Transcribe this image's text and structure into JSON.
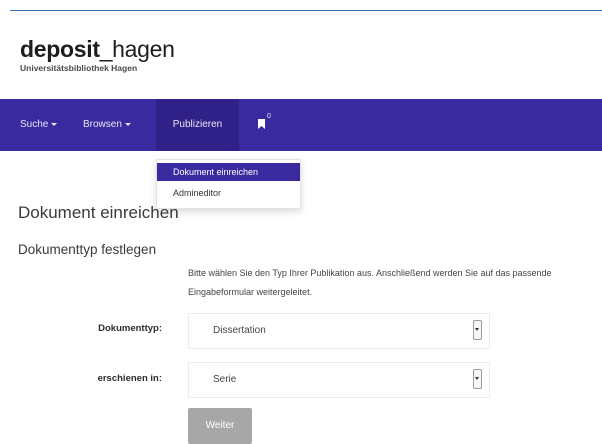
{
  "branding": {
    "logo_bold": "deposit",
    "logo_regular": "_hagen",
    "subtitle": "Universitätsbibliothek Hagen"
  },
  "navbar": {
    "items": [
      {
        "label": "Suche",
        "has_caret": true
      },
      {
        "label": "Browsen",
        "has_caret": true
      },
      {
        "label": "Publizieren",
        "has_caret": false,
        "active": true
      }
    ],
    "bookmark_icon": "bookmark-icon",
    "bookmark_count": "0"
  },
  "dropdown": {
    "items": [
      {
        "label": "Dokument einreichen",
        "selected": true
      },
      {
        "label": "Admineditor",
        "selected": false
      }
    ]
  },
  "page": {
    "title": "Dokument einreichen",
    "section_title": "Dokumenttyp festlegen",
    "intro_text": "Bitte wählen Sie den Typ Ihrer Publikation aus. Anschließend werden Sie auf das passende Eingabeformular weitergeleitet."
  },
  "form": {
    "document_type_label": "Dokumenttyp:",
    "document_type_value": "Dissertation",
    "published_in_label": "erschienen in:",
    "published_in_value": "Serie",
    "submit_label": "Weiter"
  },
  "colors": {
    "navbar": "#3a2aa0",
    "navbar_active": "#2f2188",
    "top_rule": "#2f6fb5",
    "button_disabled": "#a7a7a7"
  }
}
